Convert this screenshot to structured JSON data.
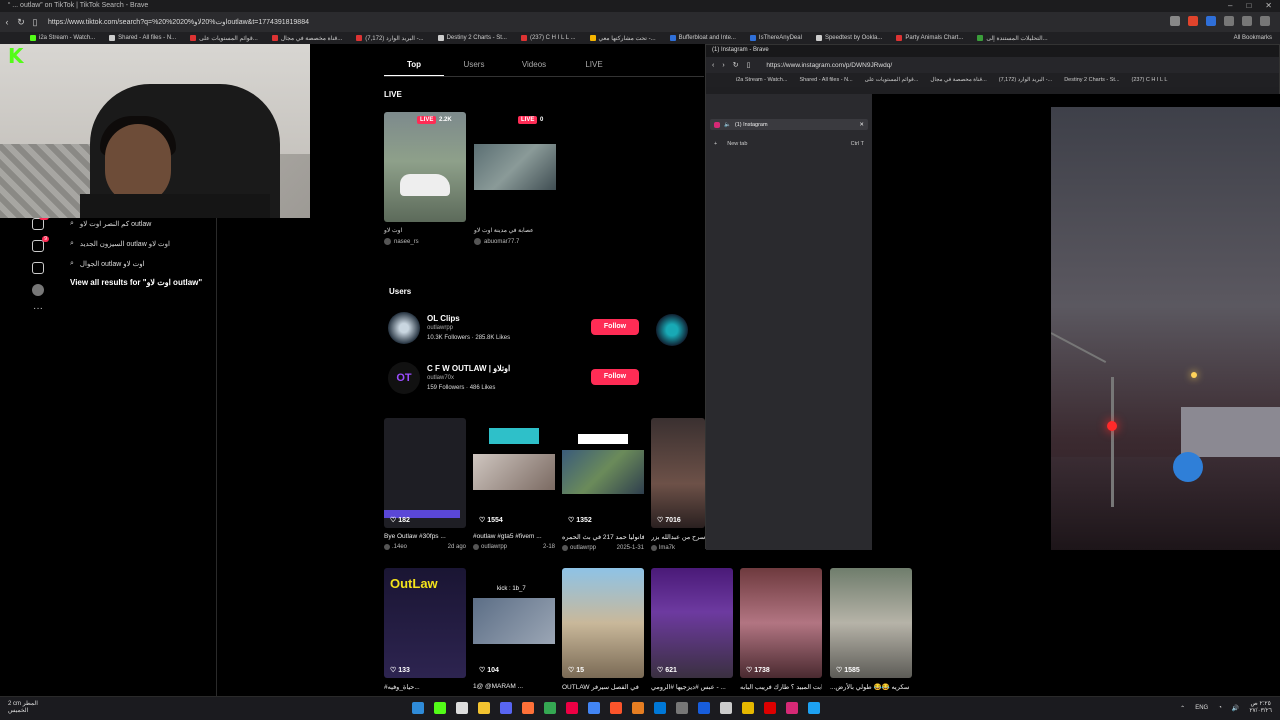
{
  "browser": {
    "title": "“ ... outlaw” on TikTok | TikTok Search - Brave",
    "url": "https://www.tiktok.com/search?q=%20%20اوت%20لاو%20outlaw&t=1774391819884",
    "bookmarks": [
      "i2a Stream - Watch...",
      "Shared - All files - N...",
      "قوائم المستويات على...",
      "قناة مخصصة في مجال...",
      "(7,172) البريد الوارد -...",
      "Destiny 2 Charts - St...",
      "(237) C H I L L ...",
      "تحت مشاركتها معي -...",
      "Bufferbloat and Inte...",
      "IsThereAnyDeal",
      "Speedtest by Ookla...",
      "Party Animals Chart...",
      "التحليلات المستندة إلى..."
    ],
    "all_bookmarks": "All Bookmarks"
  },
  "webcam": {
    "logo": "K"
  },
  "sidebar": {
    "suggestions": [
      "كم النصر اوت لاو outlaw",
      "السيزون الجديد outlaw اوت لاو",
      "الجوال outlaw اوت لاو"
    ],
    "view_all": "View all results for \"اوت لاو outlaw\"",
    "badges": {
      "inbox": "31",
      "messages": "9"
    }
  },
  "tabs": [
    {
      "label": "Top",
      "active": true
    },
    {
      "label": "Users",
      "active": false
    },
    {
      "label": "Videos",
      "active": false
    },
    {
      "label": "LIVE",
      "active": false
    }
  ],
  "live_section": {
    "title": "LIVE",
    "cards": [
      {
        "tag": "LIVE",
        "viewers": "2.2K",
        "caption": "اوت لاو",
        "user": "nasee_rs"
      },
      {
        "tag": "LIVE",
        "viewers": "0",
        "caption": "عصابة في مدينة اوت لاو",
        "user": "abuomar77.7"
      }
    ]
  },
  "users_section": {
    "title": "Users",
    "users": [
      {
        "name": "OL Clips",
        "handle": "outlawrpp",
        "followers": "10.3K Followers",
        "likes": "285.8K Likes",
        "follow": "Follow"
      },
      {
        "name": "C F W OUTLAW | اوتلاو",
        "handle": "outlaw70x",
        "followers": "159 Followers",
        "likes": "486 Likes",
        "follow": "Follow"
      }
    ]
  },
  "videos_row1": [
    {
      "likes": "182",
      "caption": "Bye Outlaw #30fps ...",
      "user": ".14eo",
      "date": "2d ago"
    },
    {
      "likes": "1554",
      "caption": "#outlaw #gta5 #fivem ...",
      "user": "outlawrpp",
      "date": "2-18"
    },
    {
      "likes": "1352",
      "caption": "فانوليا حمد 217 في بث الحمره...",
      "user": "outlawrpp",
      "date": "2025-1-31"
    },
    {
      "likes": "7016",
      "caption": "اسرح من عبدالله بزر...",
      "user": "lma7k",
      "date": ""
    }
  ],
  "videos_row2": [
    {
      "likes": "133",
      "caption": "#حياة_وفيه...",
      "thumb_text": "OutLaw"
    },
    {
      "likes": "104",
      "caption": "1@ @MARAM ...",
      "thumb_text": "kick : 1b_7"
    },
    {
      "likes": "15",
      "caption": "OUTLAW في الفصل سيرفر",
      "thumb_text": ""
    },
    {
      "likes": "621",
      "caption": "عبس #ديزجيها #الرومي - ...",
      "thumb_text": ""
    },
    {
      "likes": "1738",
      "caption": "ابت المبيد ؟ طارك فريبب البابه ...",
      "thumb_text": ""
    },
    {
      "likes": "1585",
      "caption": "...سكريه 😂😂 طولي بالأرض",
      "thumb_text": ""
    }
  ],
  "instagram_window": {
    "title": "(1) Instagram - Brave",
    "url": "https://www.instagram.com/p/DWN9JRwdq/",
    "bookmarks": [
      "i2a Stream - Watch...",
      "Shared - All files - N...",
      "قوائم المستويات على...",
      "قناة مخصصة في مجال...",
      "(7,172) البريد الوارد -...",
      "Destiny 2 Charts - St...",
      "(237) C H I L L"
    ],
    "tab_label": "(1) Instagram",
    "new_tab": "New tab",
    "new_tab_shortcut": "Ctrl T"
  },
  "taskbar": {
    "weather_temp": "2 cm",
    "weather_desc": "المطر",
    "weather_sub": "الخميس",
    "lang": "ENG",
    "time": "٢:٢٥ ص",
    "date": "٢٧/٠٣/٢٦"
  }
}
